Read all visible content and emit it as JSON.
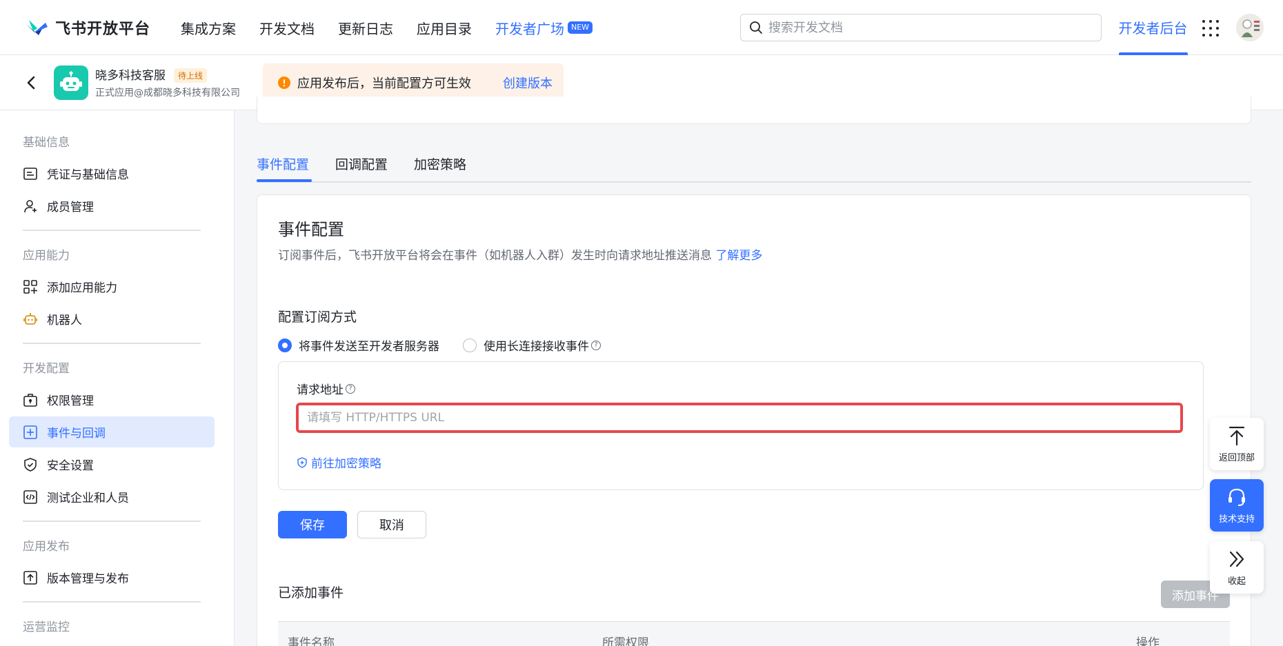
{
  "topbar": {
    "logo_text": "飞书开放平台",
    "nav": [
      "集成方案",
      "开发文档",
      "更新日志",
      "应用目录"
    ],
    "nav_accent": "开发者广场",
    "new_badge": "NEW",
    "search_placeholder": "搜索开发文档",
    "dev_console": "开发者后台"
  },
  "app": {
    "name": "晓多科技客服",
    "status": "待上线",
    "subtitle": "正式应用@成都晓多科技有限公司",
    "notice_text": "应用发布后，当前配置方可生效",
    "notice_link": "创建版本"
  },
  "sidebar": {
    "groups": {
      "basic": "基础信息",
      "capability": "应用能力",
      "dev": "开发配置",
      "release": "应用发布",
      "ops": "运营监控"
    },
    "items": {
      "credentials": "凭证与基础信息",
      "members": "成员管理",
      "add_capability": "添加应用能力",
      "robot": "机器人",
      "permissions": "权限管理",
      "events": "事件与回调",
      "security": "安全设置",
      "test_org": "测试企业和人员",
      "versions": "版本管理与发布"
    }
  },
  "tabs": [
    "事件配置",
    "回调配置",
    "加密策略"
  ],
  "event_config": {
    "title": "事件配置",
    "description": "订阅事件后，飞书开放平台将会在事件（如机器人入群）发生时向请求地址推送消息",
    "learn_more": "了解更多",
    "subscription_label": "配置订阅方式",
    "option_server": "将事件发送至开发者服务器",
    "option_longconn": "使用长连接接收事件",
    "request_url_label": "请求地址",
    "request_url_value": "",
    "request_url_placeholder": "请填写 HTTP/HTTPS URL",
    "crypto_link": "前往加密策略",
    "save": "保存",
    "cancel": "取消",
    "added_title": "已添加事件",
    "add_event": "添加事件",
    "columns": [
      "事件名称",
      "所需权限",
      "操作"
    ]
  },
  "floating": {
    "back_to_top": "返回顶部",
    "support": "技术支持",
    "collapse": "收起"
  },
  "colors": {
    "accent": "#3370ff",
    "highlight_border": "#e5484d",
    "notice_bg": "#fef1e7",
    "active_item_bg": "#e1eaff"
  }
}
